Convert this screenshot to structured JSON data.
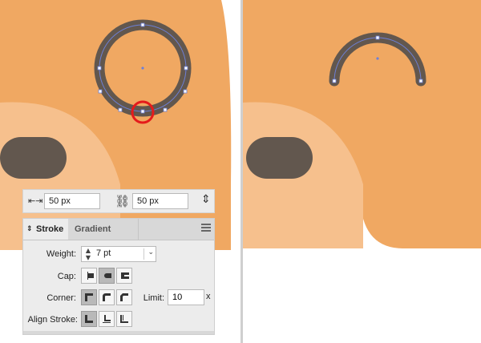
{
  "size_bar": {
    "width_icon": "width-arrows-icon",
    "width_value": "50 px",
    "link_icon": "broken-link-icon",
    "height_value": "50 px",
    "height_icon": "height-arrows-icon"
  },
  "stroke_panel": {
    "tabs": [
      {
        "label": "Stroke",
        "active": true
      },
      {
        "label": "Gradient",
        "active": false
      }
    ],
    "menu_icon": "panel-menu-icon",
    "weight_label": "Weight:",
    "weight_value": "7 pt",
    "cap_label": "Cap:",
    "cap_options": [
      "butt-cap",
      "round-cap",
      "projecting-cap"
    ],
    "cap_selected": "round-cap",
    "corner_label": "Corner:",
    "corner_options": [
      "miter-join",
      "round-join",
      "bevel-join"
    ],
    "corner_selected": "miter-join",
    "limit_label": "Limit:",
    "limit_value": "10",
    "limit_unit": "x",
    "align_label": "Align Stroke:",
    "align_options": [
      "align-center",
      "align-inside",
      "align-outside"
    ],
    "align_selected": "align-center"
  },
  "colors": {
    "background_orange": "#f0a862",
    "light_orange": "#f6c08d",
    "dark_shape": "#62574e",
    "selection_red": "#e51b1b",
    "anchor_blue": "#6d80d8"
  }
}
